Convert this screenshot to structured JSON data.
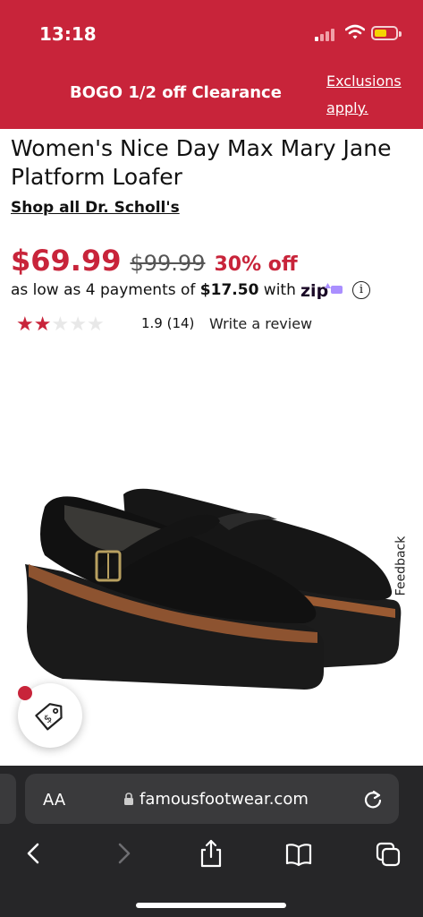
{
  "status_bar": {
    "time": "13:18"
  },
  "promo": {
    "text": "BOGO 1/2 off Clearance",
    "exclusions_link": "Exclusions apply."
  },
  "product": {
    "title": "Women's Nice Day Max Mary Jane Platform Loafer",
    "shop_all_link": "Shop all Dr. Scholl's",
    "price": {
      "sale": "$69.99",
      "original": "$99.99",
      "discount": "30% off"
    },
    "payments": {
      "prefix": "as low as 4 payments of ",
      "amount": "$17.50",
      "suffix": " with",
      "provider": "zip"
    },
    "rating": {
      "stars_filled": 2,
      "stars_total": 5,
      "value_and_count": "1.9 (14)",
      "write_review": "Write a review"
    }
  },
  "feedback_tab": "Feedback",
  "browser": {
    "text_size_label": "AA",
    "url": "famousfootwear.com"
  },
  "colors": {
    "brand_red": "#c8243a",
    "browser_dark": "#262628"
  }
}
